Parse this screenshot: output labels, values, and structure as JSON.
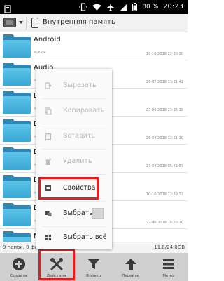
{
  "status_bar": {
    "battery_percent": "80 %",
    "time": "20:23",
    "icons": [
      "notification-icon",
      "vibrate-icon",
      "wifi-icon",
      "airplane-mode-icon",
      "signal-icon",
      "battery-icon"
    ]
  },
  "path_bar": {
    "storage_label": "Внутренняя память"
  },
  "folders": [
    {
      "name": "Android",
      "meta": "<DIR>",
      "date": "19-10-2018 22:36:30"
    },
    {
      "name": "Audio",
      "meta": "<",
      "date": "28-07-2018 13:21:42"
    },
    {
      "name": "D",
      "meta": "<",
      "date": "22-06-2018 23:35:19"
    },
    {
      "name": "D",
      "meta": "<",
      "date": "26-04-2018 12:51:10"
    },
    {
      "name": "D",
      "meta": "<",
      "date": "23-04-2018 05:42:57"
    },
    {
      "name": "D",
      "meta": "<",
      "date": "10-10-2018 22:39:32"
    },
    {
      "name": "D",
      "meta": "<",
      "date": "22-06-2018 24:36:10"
    },
    {
      "name": "M",
      "meta": "",
      "date": ""
    }
  ],
  "info_bar": {
    "left": "9 папок, 0 фай",
    "right": "11.8/24.0GB"
  },
  "context_menu": {
    "items": [
      {
        "label": "Вырезать",
        "enabled": false,
        "icon": "cut-icon"
      },
      {
        "label": "Копировать",
        "enabled": false,
        "icon": "copy-icon"
      },
      {
        "label": "Вставить",
        "enabled": false,
        "icon": "paste-icon"
      },
      {
        "label": "Удалить",
        "enabled": false,
        "icon": "delete-icon"
      },
      {
        "label": "Свойства",
        "enabled": true,
        "icon": "properties-icon"
      },
      {
        "label": "Выбрать",
        "enabled": true,
        "icon": "select-icon"
      },
      {
        "label": "Выбрать всё",
        "enabled": true,
        "icon": "select-all-icon"
      }
    ]
  },
  "toolbar": {
    "buttons": [
      {
        "label": "Создать",
        "icon": "add-icon"
      },
      {
        "label": "Действия",
        "icon": "tools-icon"
      },
      {
        "label": "Фильтр",
        "icon": "filter-icon"
      },
      {
        "label": "Перейти",
        "icon": "upload-arrow-icon"
      },
      {
        "label": "Меню",
        "icon": "menu-icon"
      }
    ]
  },
  "colors": {
    "folder_front": "#4ab6e0",
    "folder_back": "#2e88b4",
    "highlight": "#e02020",
    "toolbar_bg": "#cfcfcf"
  }
}
